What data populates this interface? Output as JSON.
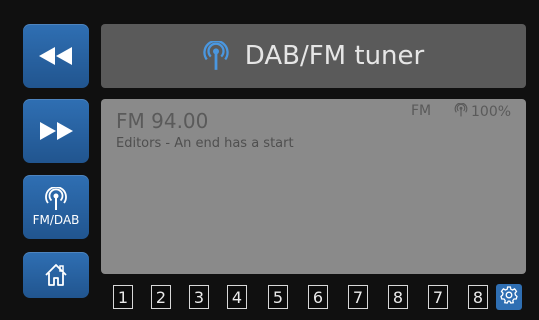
{
  "title": {
    "text": "DAB/FM tuner",
    "icon": "antenna-icon"
  },
  "sidebar": {
    "rewind": {
      "icon": "rewind-icon"
    },
    "forward": {
      "icon": "fast-forward-icon"
    },
    "source": {
      "icon": "antenna-icon",
      "label": "FM/DAB"
    },
    "home": {
      "icon": "home-icon"
    }
  },
  "display": {
    "station": "FM 94.00",
    "rds_text": "Editors - An end has a start",
    "band": "FM",
    "signal": "100%"
  },
  "presets": [
    "1",
    "2",
    "3",
    "4",
    "5",
    "6",
    "7",
    "8",
    "7",
    "8"
  ],
  "settings": {
    "icon": "gear-icon"
  },
  "colors": {
    "accent": "#2f6fb3",
    "title_bg": "#5a5a5a",
    "panel_bg": "#8a8a8a",
    "background": "#101010"
  }
}
